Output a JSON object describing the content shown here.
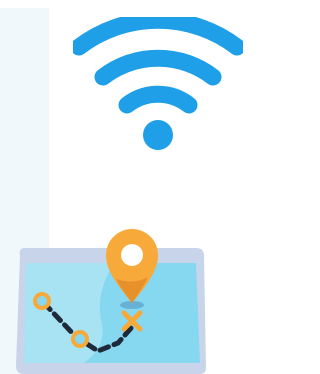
{
  "icons": [
    {
      "name": "wifi-icon",
      "color": "#1e9fe8",
      "background": "#ffffff"
    },
    {
      "name": "map-route-icon",
      "pin_color": "#f7a93a",
      "map_color": "#86d8f0",
      "frame_color": "#c8d4ea",
      "route_color": "#1e2a3a"
    }
  ],
  "panel_color": "#f1f8fc"
}
